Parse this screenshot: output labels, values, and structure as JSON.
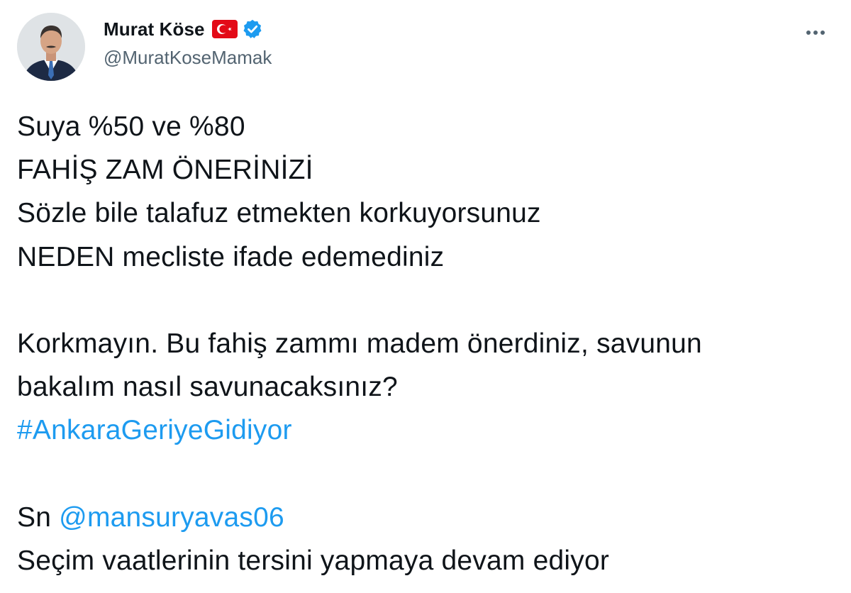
{
  "author": {
    "display_name": "Murat Köse",
    "handle": "@MuratKoseMamak",
    "badges": [
      "turkey-flag-icon",
      "verified-badge-icon"
    ]
  },
  "tweet": {
    "line1": "Suya %50 ve %80",
    "line2": "FAHİŞ ZAM ÖNERİNİZİ",
    "line3": "Sözle bile talafuz etmekten korkuyorsunuz",
    "line4": "NEDEN mecliste ifade edemediniz",
    "line5": "Korkmayın. Bu fahiş zammı madem önerdiniz, savunun",
    "line6": "bakalım nasıl savunacaksınız?",
    "hashtag": "#AnkaraGeriyeGidiyor",
    "mention_prefix": "Sn",
    "mention": "@mansuryavas06",
    "line8": "Seçim vaatlerinin tersini yapmaya devam ediyor"
  },
  "colors": {
    "link": "#1d9bf0",
    "verified": "#1d9bf0",
    "flag": "#e30a17",
    "handle": "#536471",
    "text": "#0f1419"
  }
}
